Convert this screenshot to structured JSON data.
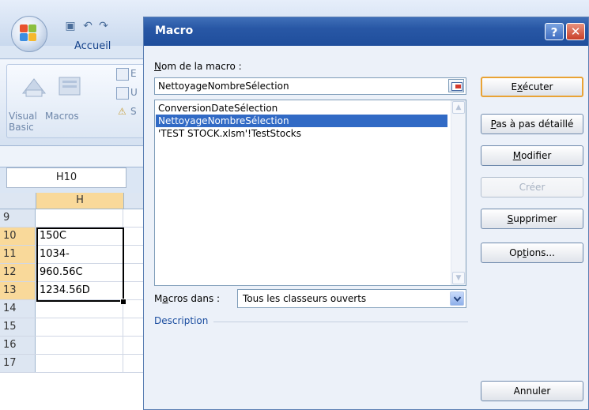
{
  "excel": {
    "ribbon_tab": "Accueil",
    "ribbon_buttons": {
      "visual_basic_line1": "Visual",
      "visual_basic_line2": "Basic",
      "macros": "Macros",
      "small_1": "E",
      "small_2": "U",
      "small_3": "S"
    },
    "name_box": "H10",
    "column_header": "H",
    "rows": [
      {
        "num": "9",
        "value": ""
      },
      {
        "num": "10",
        "value": "150C"
      },
      {
        "num": "11",
        "value": "1034-"
      },
      {
        "num": "12",
        "value": "960.56C"
      },
      {
        "num": "13",
        "value": "1234.56D"
      },
      {
        "num": "14",
        "value": ""
      },
      {
        "num": "15",
        "value": ""
      },
      {
        "num": "16",
        "value": ""
      },
      {
        "num": "17",
        "value": ""
      }
    ]
  },
  "dialog": {
    "title": "Macro",
    "name_label_first": "N",
    "name_label_rest": "om de la macro :",
    "name_value": "NettoyageNombreSélection",
    "macros": [
      {
        "name": "ConversionDateSélection",
        "selected": false
      },
      {
        "name": "NettoyageNombreSélection",
        "selected": true
      },
      {
        "name": "'TEST STOCK.xlsm'!TestStocks",
        "selected": false
      }
    ],
    "buttons": {
      "run": {
        "pre": "E",
        "key": "x",
        "post": "écuter"
      },
      "step": {
        "pre": "",
        "key": "P",
        "post": "as à pas détaillé"
      },
      "edit": {
        "pre": "",
        "key": "M",
        "post": "odifier"
      },
      "create": "Créer",
      "delete": {
        "pre": "",
        "key": "S",
        "post": "upprimer"
      },
      "options": {
        "pre": "Op",
        "key": "t",
        "post": "ions..."
      },
      "cancel": "Annuler"
    },
    "macros_in_label": {
      "pre": "M",
      "key": "a",
      "post": "cros dans :"
    },
    "macros_in_value": "Tous les classeurs ouverts",
    "description_label": "Description"
  },
  "colors": {
    "title_bar": "#2857a5",
    "selection": "#316ac5",
    "default_button_border": "#e9a335"
  }
}
